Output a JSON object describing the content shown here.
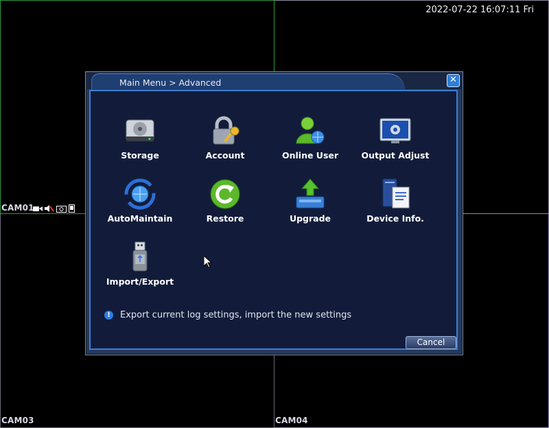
{
  "datetime": "2022-07-22 16:07:11 Fri",
  "cameras": [
    {
      "label": "CAM01"
    },
    {
      "label": "CAM03"
    },
    {
      "label": "CAM04"
    }
  ],
  "cam01_status_icons": [
    "video-camera-icon",
    "speaker-muted-icon",
    "snapshot-icon",
    "phone-icon"
  ],
  "dialog": {
    "title": "Main Menu > Advanced",
    "close_icon": "close-icon",
    "items": [
      {
        "label": "Storage",
        "icon": "hard-drive-icon"
      },
      {
        "label": "Account",
        "icon": "padlock-key-icon"
      },
      {
        "label": "Online User",
        "icon": "online-user-icon"
      },
      {
        "label": "Output Adjust",
        "icon": "monitor-gear-icon"
      },
      {
        "label": "AutoMaintain",
        "icon": "auto-maintain-icon"
      },
      {
        "label": "Restore",
        "icon": "restore-icon"
      },
      {
        "label": "Upgrade",
        "icon": "upgrade-icon"
      },
      {
        "label": "Device Info.",
        "icon": "device-info-icon"
      },
      {
        "label": "Import/Export",
        "icon": "usb-drive-icon"
      }
    ],
    "hint": "Export current log settings, import the new settings",
    "cancel_label": "Cancel"
  },
  "colors": {
    "dialog_bg": "#121c3a",
    "accent_blue": "#3e7fd0",
    "title_bar": "#1f3e72"
  }
}
